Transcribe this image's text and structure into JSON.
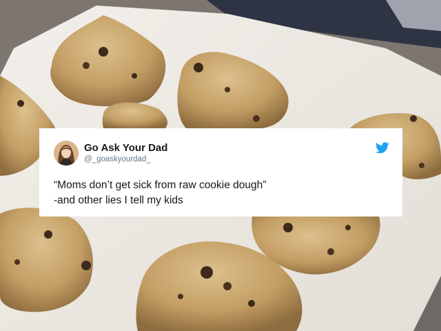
{
  "tweet": {
    "display_name": "Go Ask Your Dad",
    "handle": "@_goaskyourdad_",
    "line1": "“Moms don’t get sick from raw cookie dough”",
    "line2": "-and other lies I tell my kids",
    "bird_icon": "twitter-bird-icon",
    "accent": "#1da1f2"
  },
  "background": {
    "subject": "cookie-dough-balls-on-baking-sheet",
    "dough_color": "#c9a66e",
    "paper_color": "#ece8e2",
    "tray_color": "#8c8783"
  }
}
